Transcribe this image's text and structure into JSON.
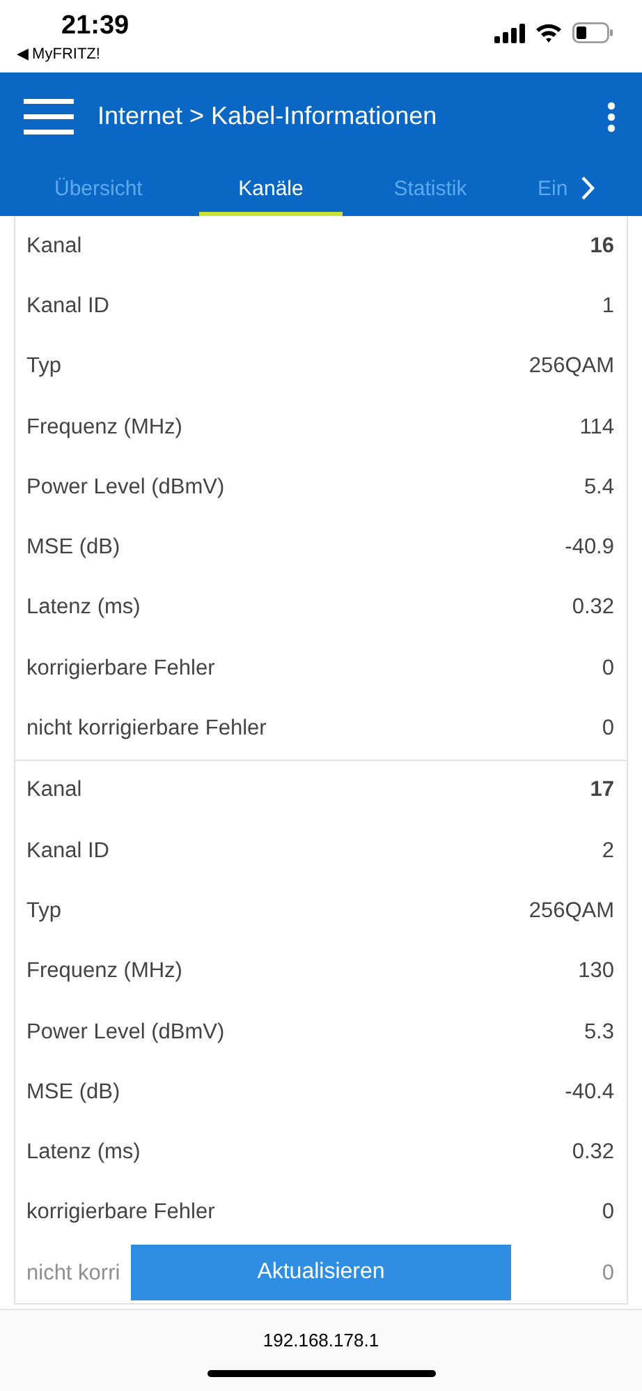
{
  "status_bar": {
    "time": "21:39",
    "back_label": "◀ MyFRITZ!"
  },
  "header": {
    "title": "Internet > Kabel-Informationen"
  },
  "tabs": [
    {
      "label": "Übersicht",
      "selected": false
    },
    {
      "label": "Kanäle",
      "selected": true
    },
    {
      "label": "Statistik",
      "selected": false
    },
    {
      "label": "Ein",
      "selected": false
    }
  ],
  "channels": [
    {
      "rows": [
        {
          "kind": "heading",
          "label": "Kanal",
          "value": "16"
        },
        {
          "kind": "field",
          "label": "Kanal ID",
          "value": "1"
        },
        {
          "kind": "field",
          "label": "Typ",
          "value": "256QAM"
        },
        {
          "kind": "field",
          "label": "Frequenz (MHz)",
          "value": "114"
        },
        {
          "kind": "field",
          "label": "Power Level (dBmV)",
          "value": "5.4"
        },
        {
          "kind": "field",
          "label": "MSE (dB)",
          "value": "-40.9"
        },
        {
          "kind": "field",
          "label": "Latenz (ms)",
          "value": "0.32"
        },
        {
          "kind": "field",
          "label": "korrigierbare Fehler",
          "value": "0"
        },
        {
          "kind": "field",
          "label": "nicht korrigierbare Fehler",
          "value": "0"
        }
      ]
    },
    {
      "rows": [
        {
          "kind": "heading",
          "label": "Kanal",
          "value": "17"
        },
        {
          "kind": "field",
          "label": "Kanal ID",
          "value": "2"
        },
        {
          "kind": "field",
          "label": "Typ",
          "value": "256QAM"
        },
        {
          "kind": "field",
          "label": "Frequenz (MHz)",
          "value": "130"
        },
        {
          "kind": "field",
          "label": "Power Level (dBmV)",
          "value": "5.3"
        },
        {
          "kind": "field",
          "label": "MSE (dB)",
          "value": "-40.4"
        },
        {
          "kind": "field",
          "label": "Latenz (ms)",
          "value": "0.32"
        },
        {
          "kind": "field",
          "label": "korrigierbare Fehler",
          "value": "0"
        },
        {
          "kind": "faded",
          "label": "nicht korri",
          "value": "0"
        }
      ]
    }
  ],
  "refresh_button": {
    "label": "Aktualisieren"
  },
  "address_bar": {
    "url": "192.168.178.1"
  }
}
